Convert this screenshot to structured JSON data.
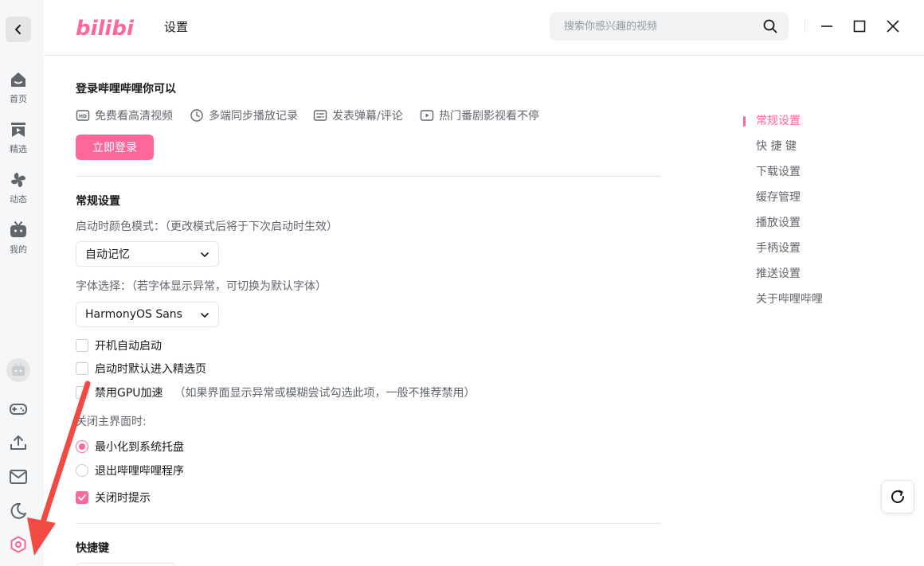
{
  "app": {
    "logo_text": "bilibili",
    "page_title": "设置"
  },
  "search": {
    "placeholder": "搜索你感兴趣的视频"
  },
  "nav": [
    {
      "label": "首页",
      "icon": "home-icon"
    },
    {
      "label": "精选",
      "icon": "featured-icon"
    },
    {
      "label": "动态",
      "icon": "pinwheel-icon"
    },
    {
      "label": "我的",
      "icon": "tv-icon"
    }
  ],
  "login": {
    "title": "登录哔哩哔哩你可以",
    "perks": [
      "免费看高清视频",
      "多端同步播放记录",
      "发表弹幕/评论",
      "热门番剧影视看不停"
    ],
    "button": "立即登录"
  },
  "general": {
    "title": "常规设置",
    "color_mode_label": "启动时颜色模式：（更改模式后将于下次启动时生效）",
    "color_mode_value": "自动记忆",
    "font_label": "字体选择：（若字体显示异常，可切换为默认字体）",
    "font_value": "HarmonyOS Sans",
    "checkboxes": [
      {
        "label": "开机自动启动",
        "checked": false,
        "hint": ""
      },
      {
        "label": "启动时默认进入精选页",
        "checked": false,
        "hint": ""
      },
      {
        "label": "禁用GPU加速",
        "checked": false,
        "hint": "（如果界面显示异常或模糊尝试勾选此项，一般不推荐禁用）"
      }
    ],
    "close_label": "关闭主界面时:",
    "close_options": [
      {
        "label": "最小化到系统托盘",
        "checked": true
      },
      {
        "label": "退出哔哩哔哩程序",
        "checked": false
      }
    ],
    "close_prompt": {
      "label": "关闭时提示",
      "checked": true
    }
  },
  "shortcuts": {
    "title": "快捷键"
  },
  "toc": [
    {
      "label": "常规设置",
      "active": true
    },
    {
      "label": "快 捷 键",
      "active": false
    },
    {
      "label": "下载设置",
      "active": false
    },
    {
      "label": "缓存管理",
      "active": false
    },
    {
      "label": "播放设置",
      "active": false
    },
    {
      "label": "手柄设置",
      "active": false
    },
    {
      "label": "推送设置",
      "active": false
    },
    {
      "label": "关于哔哩哔哩",
      "active": false
    }
  ],
  "colors": {
    "accent": "#ff6699",
    "annotation_arrow": "#f04a42"
  }
}
